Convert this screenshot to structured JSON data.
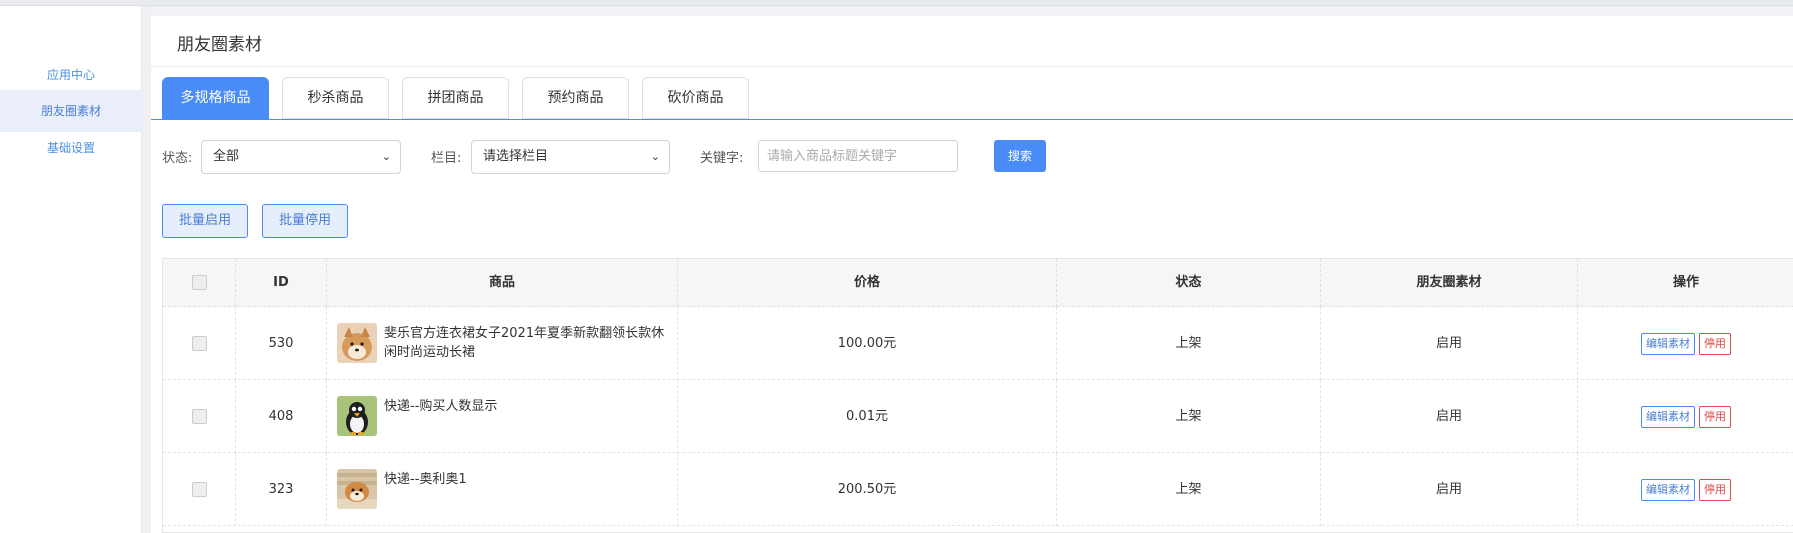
{
  "sidebar": {
    "items": [
      {
        "label": "应用中心",
        "active": false
      },
      {
        "label": "朋友圈素材",
        "active": true
      },
      {
        "label": "基础设置",
        "active": false
      }
    ]
  },
  "page": {
    "title": "朋友圈素材"
  },
  "tabs": [
    {
      "label": "多规格商品",
      "active": true
    },
    {
      "label": "秒杀商品",
      "active": false
    },
    {
      "label": "拼团商品",
      "active": false
    },
    {
      "label": "预约商品",
      "active": false
    },
    {
      "label": "砍价商品",
      "active": false
    }
  ],
  "filters": {
    "status_label": "状态:",
    "status_value": "全部",
    "column_label": "栏目:",
    "column_value": "请选择栏目",
    "keyword_label": "关键字:",
    "keyword_placeholder": "请输入商品标题关键字",
    "search_button": "搜索"
  },
  "batch": {
    "enable_label": "批量启用",
    "disable_label": "批量停用"
  },
  "table": {
    "headers": {
      "id": "ID",
      "product": "商品",
      "price": "价格",
      "status": "状态",
      "material": "朋友圈素材",
      "actions": "操作"
    },
    "rows": [
      {
        "id": "530",
        "name": "斐乐官方连衣裙女子2021年夏季新款翻领长款休闲时尚运动长裙",
        "price": "100.00元",
        "status": "上架",
        "material": "启用",
        "edit": "编辑素材",
        "stop": "停用",
        "thumb": "shiba-dog"
      },
      {
        "id": "408",
        "name": "快递--购买人数显示",
        "price": "0.01元",
        "status": "上架",
        "material": "启用",
        "edit": "编辑素材",
        "stop": "停用",
        "thumb": "penguin"
      },
      {
        "id": "323",
        "name": "快递--奥利奥1",
        "price": "200.50元",
        "status": "上架",
        "material": "启用",
        "edit": "编辑素材",
        "stop": "停用",
        "thumb": "shiba-dog-blanket"
      }
    ]
  },
  "colors": {
    "accent": "#4a8cf7",
    "danger": "#e04848",
    "sidebar_active_bg": "#e9eefa"
  }
}
